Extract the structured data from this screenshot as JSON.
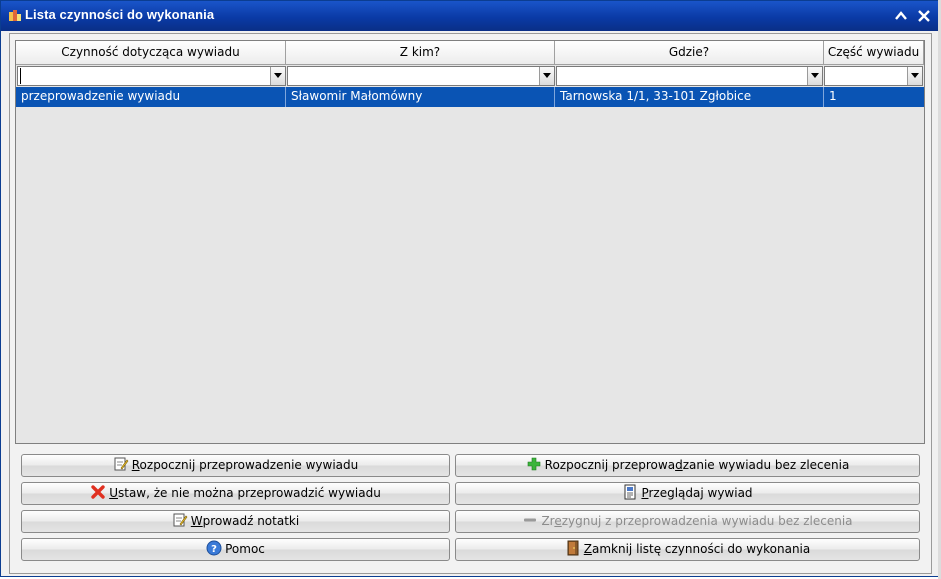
{
  "window": {
    "title": "Lista czynności do wykonania"
  },
  "columns": [
    "Czynność dotycząca wywiadu",
    "Z kim?",
    "Gdzie?",
    "Część wywiadu"
  ],
  "filters": [
    "",
    "",
    "",
    ""
  ],
  "rows": [
    [
      "przeprowadzenie wywiadu",
      "Sławomir Małomówny",
      "Tarnowska 1/1, 33-101 Zgłobice",
      "1"
    ]
  ],
  "buttons": {
    "start": {
      "pre": "",
      "u": "R",
      "post": "ozpocznij przeprowadzenie wywiadu"
    },
    "start_no_order": {
      "pre": "Rozpocznij przeprowa",
      "u": "d",
      "post": "zanie wywiadu bez zlecenia"
    },
    "cannot": {
      "pre": "",
      "u": "U",
      "post": "staw, że nie można przeprowadzić wywiadu"
    },
    "view": {
      "pre": "",
      "u": "P",
      "post": "rzeglądaj wywiad"
    },
    "notes": {
      "pre": "",
      "u": "W",
      "post": "prowadź notatki"
    },
    "resign": {
      "pre": "Zr",
      "u": "e",
      "post": "zygnuj z przeprowadzenia wywiadu bez zlecenia"
    },
    "help": {
      "pre": "Pomoc",
      "u": "",
      "post": ""
    },
    "close": {
      "pre": "",
      "u": "Z",
      "post": "amknij listę czynności do wykonania"
    }
  },
  "colors": {
    "title_bar": "#0a3aa6",
    "selection": "#0a54b4",
    "add": "#3cb43c",
    "delete": "#e03020"
  }
}
